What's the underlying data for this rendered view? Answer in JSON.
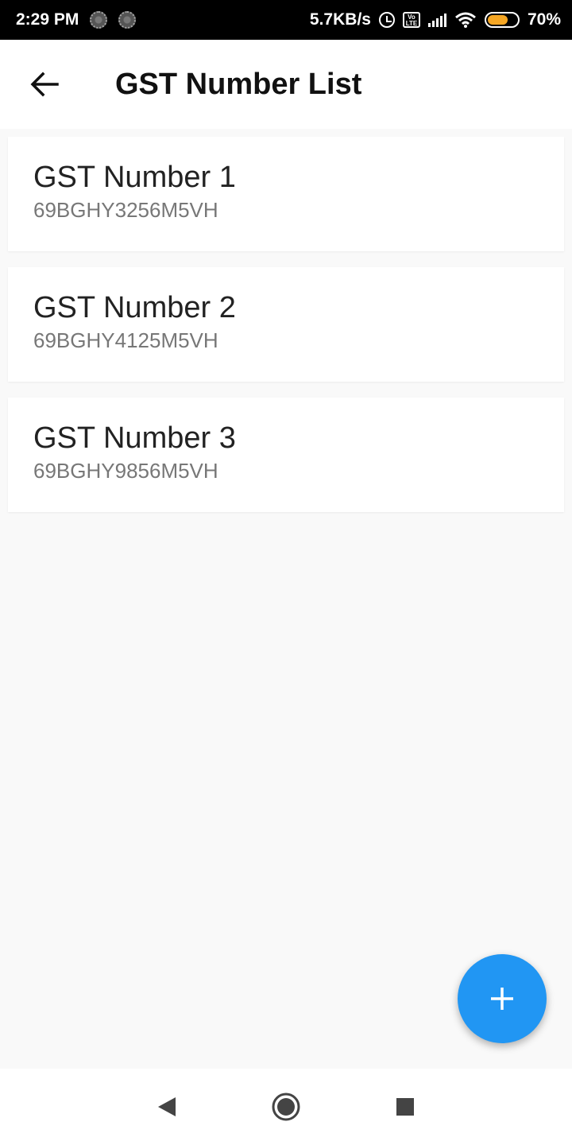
{
  "status_bar": {
    "time": "2:29 PM",
    "network_speed": "5.7KB/s",
    "volte_label": "Vo LTE",
    "battery_percent": "70%",
    "battery_level": 0.7,
    "icons": [
      "notification-icon",
      "notification-icon",
      "alarm-icon",
      "volte-icon",
      "signal-icon",
      "wifi-icon",
      "battery-icon"
    ]
  },
  "app_bar": {
    "back_icon": "arrow-left-icon",
    "title": "GST Number List"
  },
  "gst_list": [
    {
      "title": "GST Number 1",
      "number": "69BGHY3256M5VH"
    },
    {
      "title": "GST Number 2",
      "number": "69BGHY4125M5VH"
    },
    {
      "title": "GST Number 3",
      "number": "69BGHY9856M5VH"
    }
  ],
  "fab": {
    "icon": "plus-icon",
    "color": "#2196f3"
  },
  "nav_bar": {
    "icons": [
      "back-triangle-icon",
      "home-circle-icon",
      "recents-square-icon"
    ]
  }
}
